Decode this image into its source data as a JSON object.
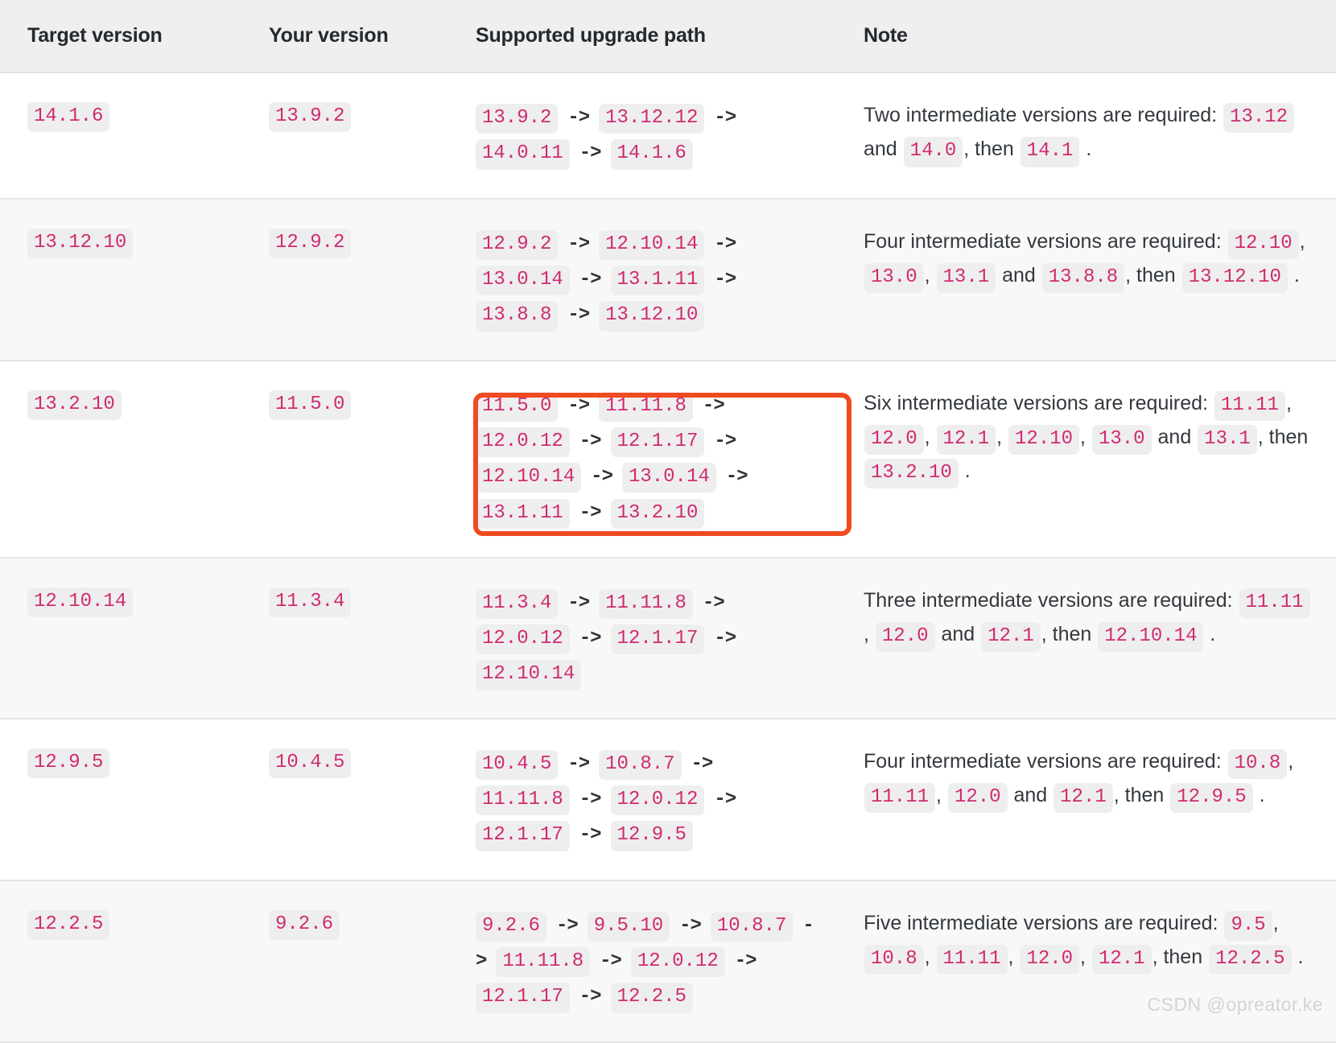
{
  "table": {
    "columns": [
      "Target version",
      "Your version",
      "Supported upgrade path",
      "Note"
    ],
    "rows": [
      {
        "target": "14.1.6",
        "your": "13.9.2",
        "path": [
          "13.9.2",
          "13.12.12",
          "14.0.11",
          "14.1.6"
        ],
        "note_lead": "Two intermediate versions are required:",
        "note_versions": [
          "13.12",
          "14.0"
        ],
        "note_joiner": "and",
        "note_then": ", then",
        "note_final": "14.1",
        "note_end": ".",
        "note_text": "Two intermediate versions are required: 13.12 and 14.0 , then 14.1 ."
      },
      {
        "target": "13.12.10",
        "your": "12.9.2",
        "path": [
          "12.9.2",
          "12.10.14",
          "13.0.14",
          "13.1.11",
          "13.8.8",
          "13.12.10"
        ],
        "note_lead": "Four intermediate versions are required:",
        "note_versions": [
          "12.10",
          "13.0",
          "13.1",
          "13.8.8"
        ],
        "note_joiner": "and",
        "note_then": ", then",
        "note_final": "13.12.10",
        "note_end": ".",
        "note_text": "Four intermediate versions are required: 12.10 , 13.0 , 13.1 and 13.8.8 , then 13.12.10 ."
      },
      {
        "target": "13.2.10",
        "your": "11.5.0",
        "path": [
          "11.5.0",
          "11.11.8",
          "12.0.12",
          "12.1.17",
          "12.10.14",
          "13.0.14",
          "13.1.11",
          "13.2.10"
        ],
        "note_lead": "Six intermediate versions are required:",
        "note_versions": [
          "11.11",
          "12.0",
          "12.1",
          "12.10",
          "13.0",
          "13.1"
        ],
        "note_joiner": "and",
        "note_then": ", then",
        "note_final": "13.2.10",
        "note_end": ".",
        "note_text": "Six intermediate versions are required: 11.11 , 12.0 , 12.1 , 12.10 , 13.0 and 13.1 , then 13.2.10 .",
        "highlighted": true
      },
      {
        "target": "12.10.14",
        "your": "11.3.4",
        "path": [
          "11.3.4",
          "11.11.8",
          "12.0.12",
          "12.1.17",
          "12.10.14"
        ],
        "note_lead": "Three intermediate versions are required:",
        "note_versions": [
          "11.11",
          "12.0",
          "12.1"
        ],
        "note_joiner": "and",
        "note_then": ", then",
        "note_final": "12.10.14",
        "note_end": ".",
        "note_text": "Three intermediate versions are required: 11.11 , 12.0 and 12.1 , then 12.10.14 ."
      },
      {
        "target": "12.9.5",
        "your": "10.4.5",
        "path": [
          "10.4.5",
          "10.8.7",
          "11.11.8",
          "12.0.12",
          "12.1.17",
          "12.9.5"
        ],
        "note_lead": "Four intermediate versions are required:",
        "note_versions": [
          "10.8",
          "11.11",
          "12.0",
          "12.1"
        ],
        "note_joiner": "and",
        "note_then": ", then",
        "note_final": "12.9.5",
        "note_end": ".",
        "note_text": "Four intermediate versions are required: 10.8 , 11.11 , 12.0 and 12.1 , then 12.9.5 ."
      },
      {
        "target": "12.2.5",
        "your": "9.2.6",
        "path": [
          "9.2.6",
          "9.5.10",
          "10.8.7",
          "11.11.8",
          "12.0.12",
          "12.1.17",
          "12.2.5"
        ],
        "note_lead": "Five intermediate versions are required:",
        "note_versions": [
          "9.5",
          "10.8",
          "11.11",
          "12.0",
          "12.1"
        ],
        "note_joiner": "",
        "note_then": ", then",
        "note_final": "12.2.5",
        "note_end": ".",
        "note_text": "Five intermediate versions are required: 9.5 , 10.8 , 11.11 , 12.0 , 12.1 , then 12.2.5 ."
      }
    ],
    "arrow_glyph": "->"
  },
  "highlight": {
    "color": "#f04a20",
    "row_index": 2,
    "column": "Supported upgrade path"
  },
  "colors": {
    "code_text": "#cf2b72",
    "code_bg": "#efeeee",
    "header_bg": "#efefef",
    "row_alt_bg": "#f8f8f8",
    "highlight": "#f04a20"
  },
  "watermark": "CSDN @opreator.ke"
}
